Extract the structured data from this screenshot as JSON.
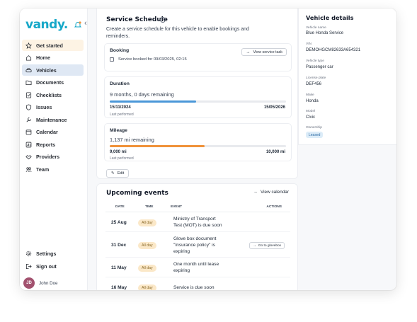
{
  "app": {
    "logo_text": "vandy.",
    "brand_color": "#17a8c8"
  },
  "sidebar": {
    "items": [
      {
        "label": "Get started",
        "icon": "star-icon"
      },
      {
        "label": "Home",
        "icon": "home-icon"
      },
      {
        "label": "Vehicles",
        "icon": "car-icon"
      },
      {
        "label": "Documents",
        "icon": "folder-icon"
      },
      {
        "label": "Checklists",
        "icon": "checklist-icon"
      },
      {
        "label": "Issues",
        "icon": "shield-icon"
      },
      {
        "label": "Maintenance",
        "icon": "wrench-icon"
      },
      {
        "label": "Calendar",
        "icon": "calendar-icon"
      },
      {
        "label": "Reports",
        "icon": "chart-icon"
      },
      {
        "label": "Providers",
        "icon": "handshake-icon"
      },
      {
        "label": "Team",
        "icon": "team-icon"
      }
    ],
    "bottom": [
      {
        "label": "Settings",
        "icon": "gear-icon"
      },
      {
        "label": "Sign out",
        "icon": "sign-out-icon"
      }
    ],
    "user": {
      "initials": "JD",
      "name": "John Doe"
    }
  },
  "schedule": {
    "title": "Service Schedule",
    "description": "Create a service schedule for this vehicle to enable bookings and reminders.",
    "booking": {
      "title": "Booking",
      "text": "Service booked for 09/03/2025, 02:15",
      "button": "View service task"
    },
    "duration": {
      "title": "Duration",
      "remaining": "9 months, 0 days remaining",
      "progress": 0.49,
      "start": "15/11/2024",
      "end": "15/05/2026",
      "last_performed": "Last performed",
      "color": "#4a97d8"
    },
    "mileage": {
      "title": "Mileage",
      "remaining": "1,137 mi remaining",
      "progress": 0.54,
      "start": "9,000 mi",
      "end": "10,000 mi",
      "last_performed": "Last performed",
      "color": "#f0923a"
    },
    "edit_label": "Edit"
  },
  "events": {
    "title": "Upcoming events",
    "view_calendar": "View calendar",
    "columns": {
      "date": "DATE",
      "time": "TIME",
      "event": "EVENT",
      "actions": "ACTIONS"
    },
    "rows": [
      {
        "date": "25 Aug",
        "time": "All day",
        "line1": "Ministry of Transport",
        "line2": "Test (MOT) is due soon",
        "line3": "",
        "action": ""
      },
      {
        "date": "31 Dec",
        "time": "All day",
        "line1": "Glove box document",
        "line2": "\"Insurance policy\" is",
        "line3": "expiring",
        "action": "Go to glovebox"
      },
      {
        "date": "11 May",
        "time": "All day",
        "line1": "One month until lease",
        "line2": "expiring",
        "line3": "",
        "action": ""
      },
      {
        "date": "16 May",
        "time": "All day",
        "line1": "Service is due soon",
        "line2": "",
        "line3": "",
        "action": ""
      }
    ]
  },
  "details": {
    "title": "Vehicle details",
    "fields": [
      {
        "label": "Vehicle name",
        "value": "Blue Honda Service"
      },
      {
        "label": "VIN",
        "value": "DEMOHGCM82633A654321"
      },
      {
        "label": "Vehicle type",
        "value": "Passenger car"
      },
      {
        "label": "License plate",
        "value": "DEF456"
      },
      {
        "label": "Make",
        "value": "Honda"
      },
      {
        "label": "Model",
        "value": "Civic"
      }
    ],
    "ownership_label": "Ownership",
    "ownership_value": "Leased"
  }
}
